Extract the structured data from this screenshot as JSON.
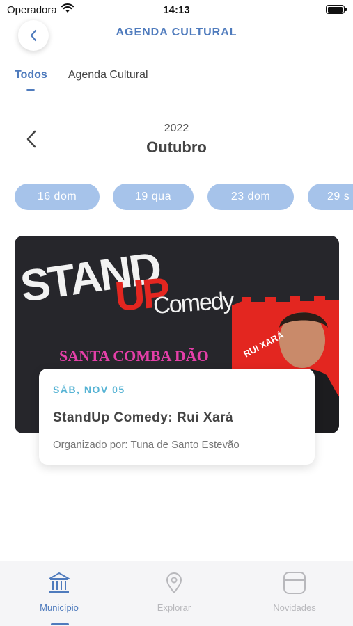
{
  "status_bar": {
    "carrier": "Operadora",
    "time": "14:13"
  },
  "header": {
    "title": "AGENDA CULTURAL",
    "back_icon": "chevron-left-icon"
  },
  "tabs": [
    {
      "label": "Todos",
      "active": true
    },
    {
      "label": "Agenda Cultural",
      "active": false
    }
  ],
  "calendar": {
    "year": "2022",
    "month": "Outubro"
  },
  "date_chips": [
    "16 dom",
    "19 qua",
    "23 dom",
    "29 s"
  ],
  "event": {
    "banner": {
      "line1": "STAND",
      "line2": "UP",
      "line3": "Comedy",
      "location": "SANTA COMBA DÃO",
      "performer_tag": "RUI XARÁ"
    },
    "date": "SÁB, NOV 05",
    "title": "StandUp Comedy: Rui Xará",
    "organizer": "Organizado por: Tuna de Santo Estevão"
  },
  "bottom_nav": [
    {
      "label": "Município",
      "icon": "bank-icon",
      "active": true
    },
    {
      "label": "Explorar",
      "icon": "map-pin-icon",
      "active": false
    },
    {
      "label": "Novidades",
      "icon": "card-icon",
      "active": false
    }
  ],
  "colors": {
    "accent": "#4f7bbd",
    "chip": "#a6c3ea",
    "event_date": "#56b3d4",
    "banner_red": "#e32620"
  }
}
